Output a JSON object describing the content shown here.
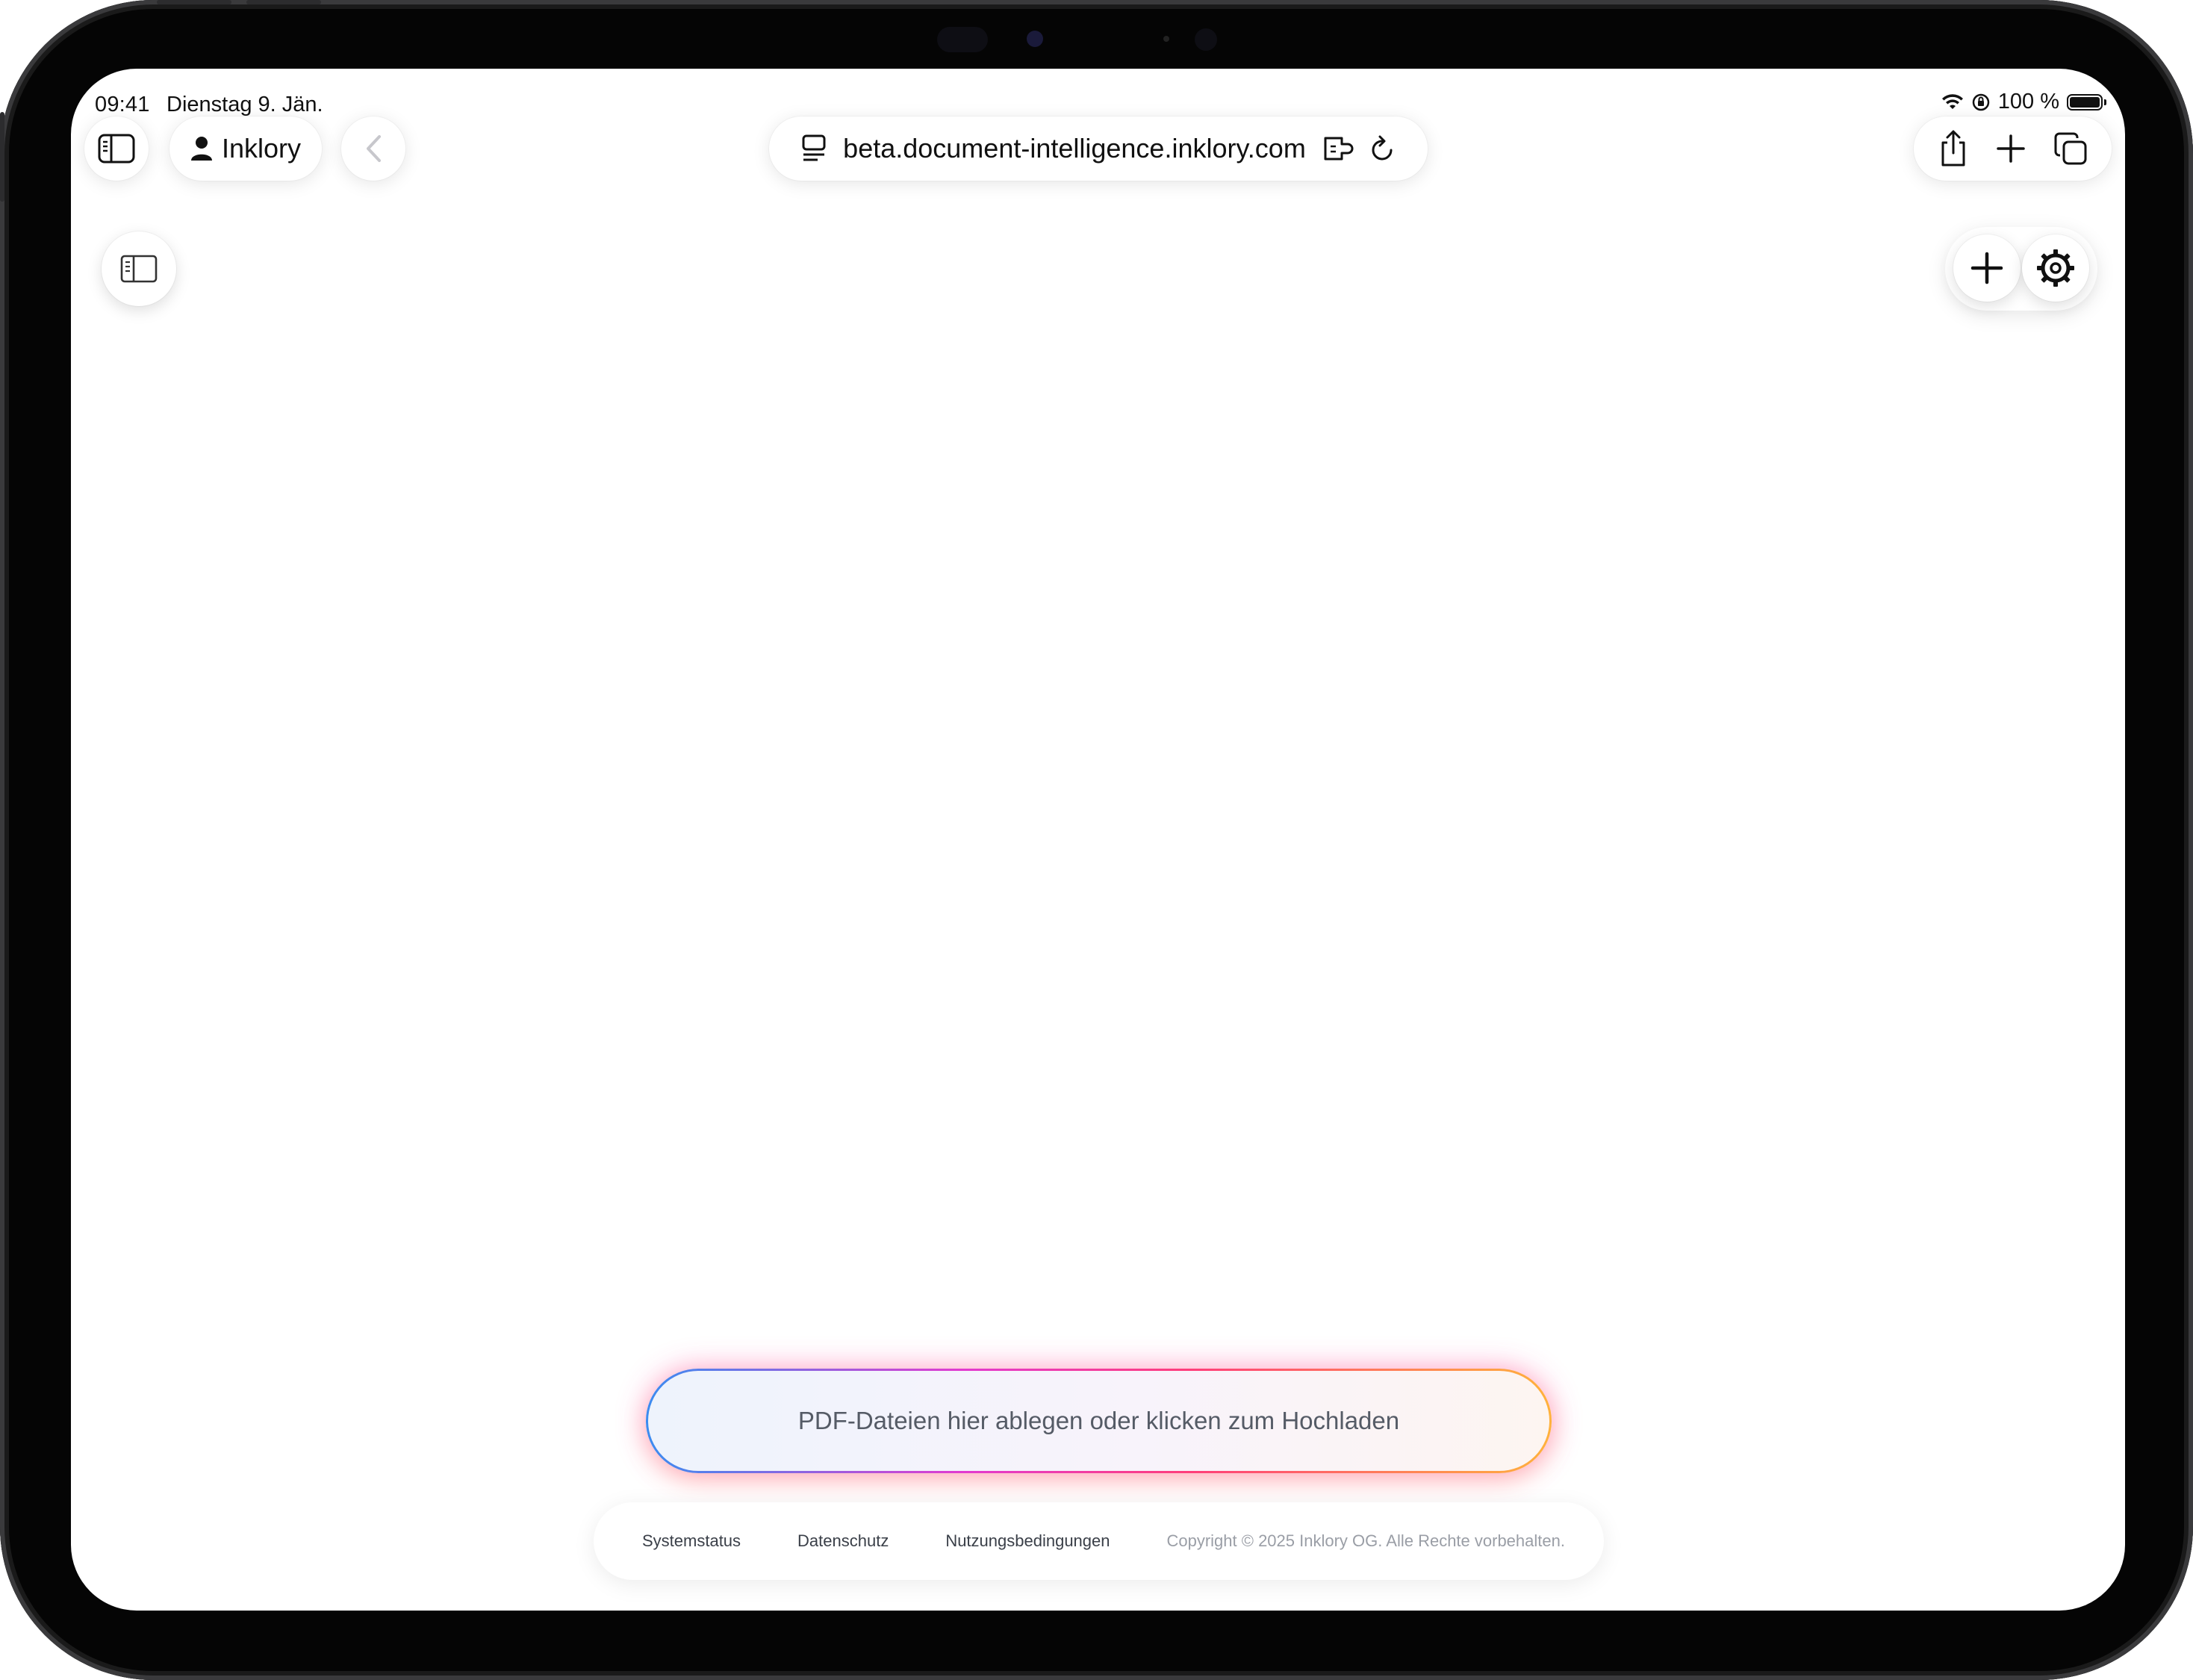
{
  "status_bar": {
    "time": "09:41",
    "date": "Dienstag 9. Jän.",
    "battery": "100 %",
    "icons": [
      "wifi-icon",
      "orientation-lock-icon",
      "battery-icon"
    ]
  },
  "browser": {
    "profile_label": "Inklory",
    "url": "beta.document-intelligence.inklory.com",
    "icons": [
      "sidebar-icon",
      "person-icon",
      "back-chevron-icon",
      "page-menu-icon",
      "extension-icon",
      "reload-icon",
      "share-icon",
      "plus-icon",
      "tabs-icon"
    ]
  },
  "page": {
    "upload_text": "PDF-Dateien hier ablegen oder klicken zum Hochladen",
    "footer": {
      "links": [
        "Systemstatus",
        "Datenschutz",
        "Nutzungsbedingungen"
      ],
      "copyright": "Copyright © 2025 Inklory OG. Alle Rechte vorbehalten."
    },
    "icons": [
      "sidebar-toggle-icon",
      "new-chat-plus-icon",
      "settings-gear-icon"
    ]
  },
  "colors": {
    "upload_gradient": [
      "#3b8cf0",
      "#e23ad0",
      "#ff3d7a",
      "#ffb23c"
    ],
    "text": "#111111",
    "muted": "#9a9ea6"
  }
}
